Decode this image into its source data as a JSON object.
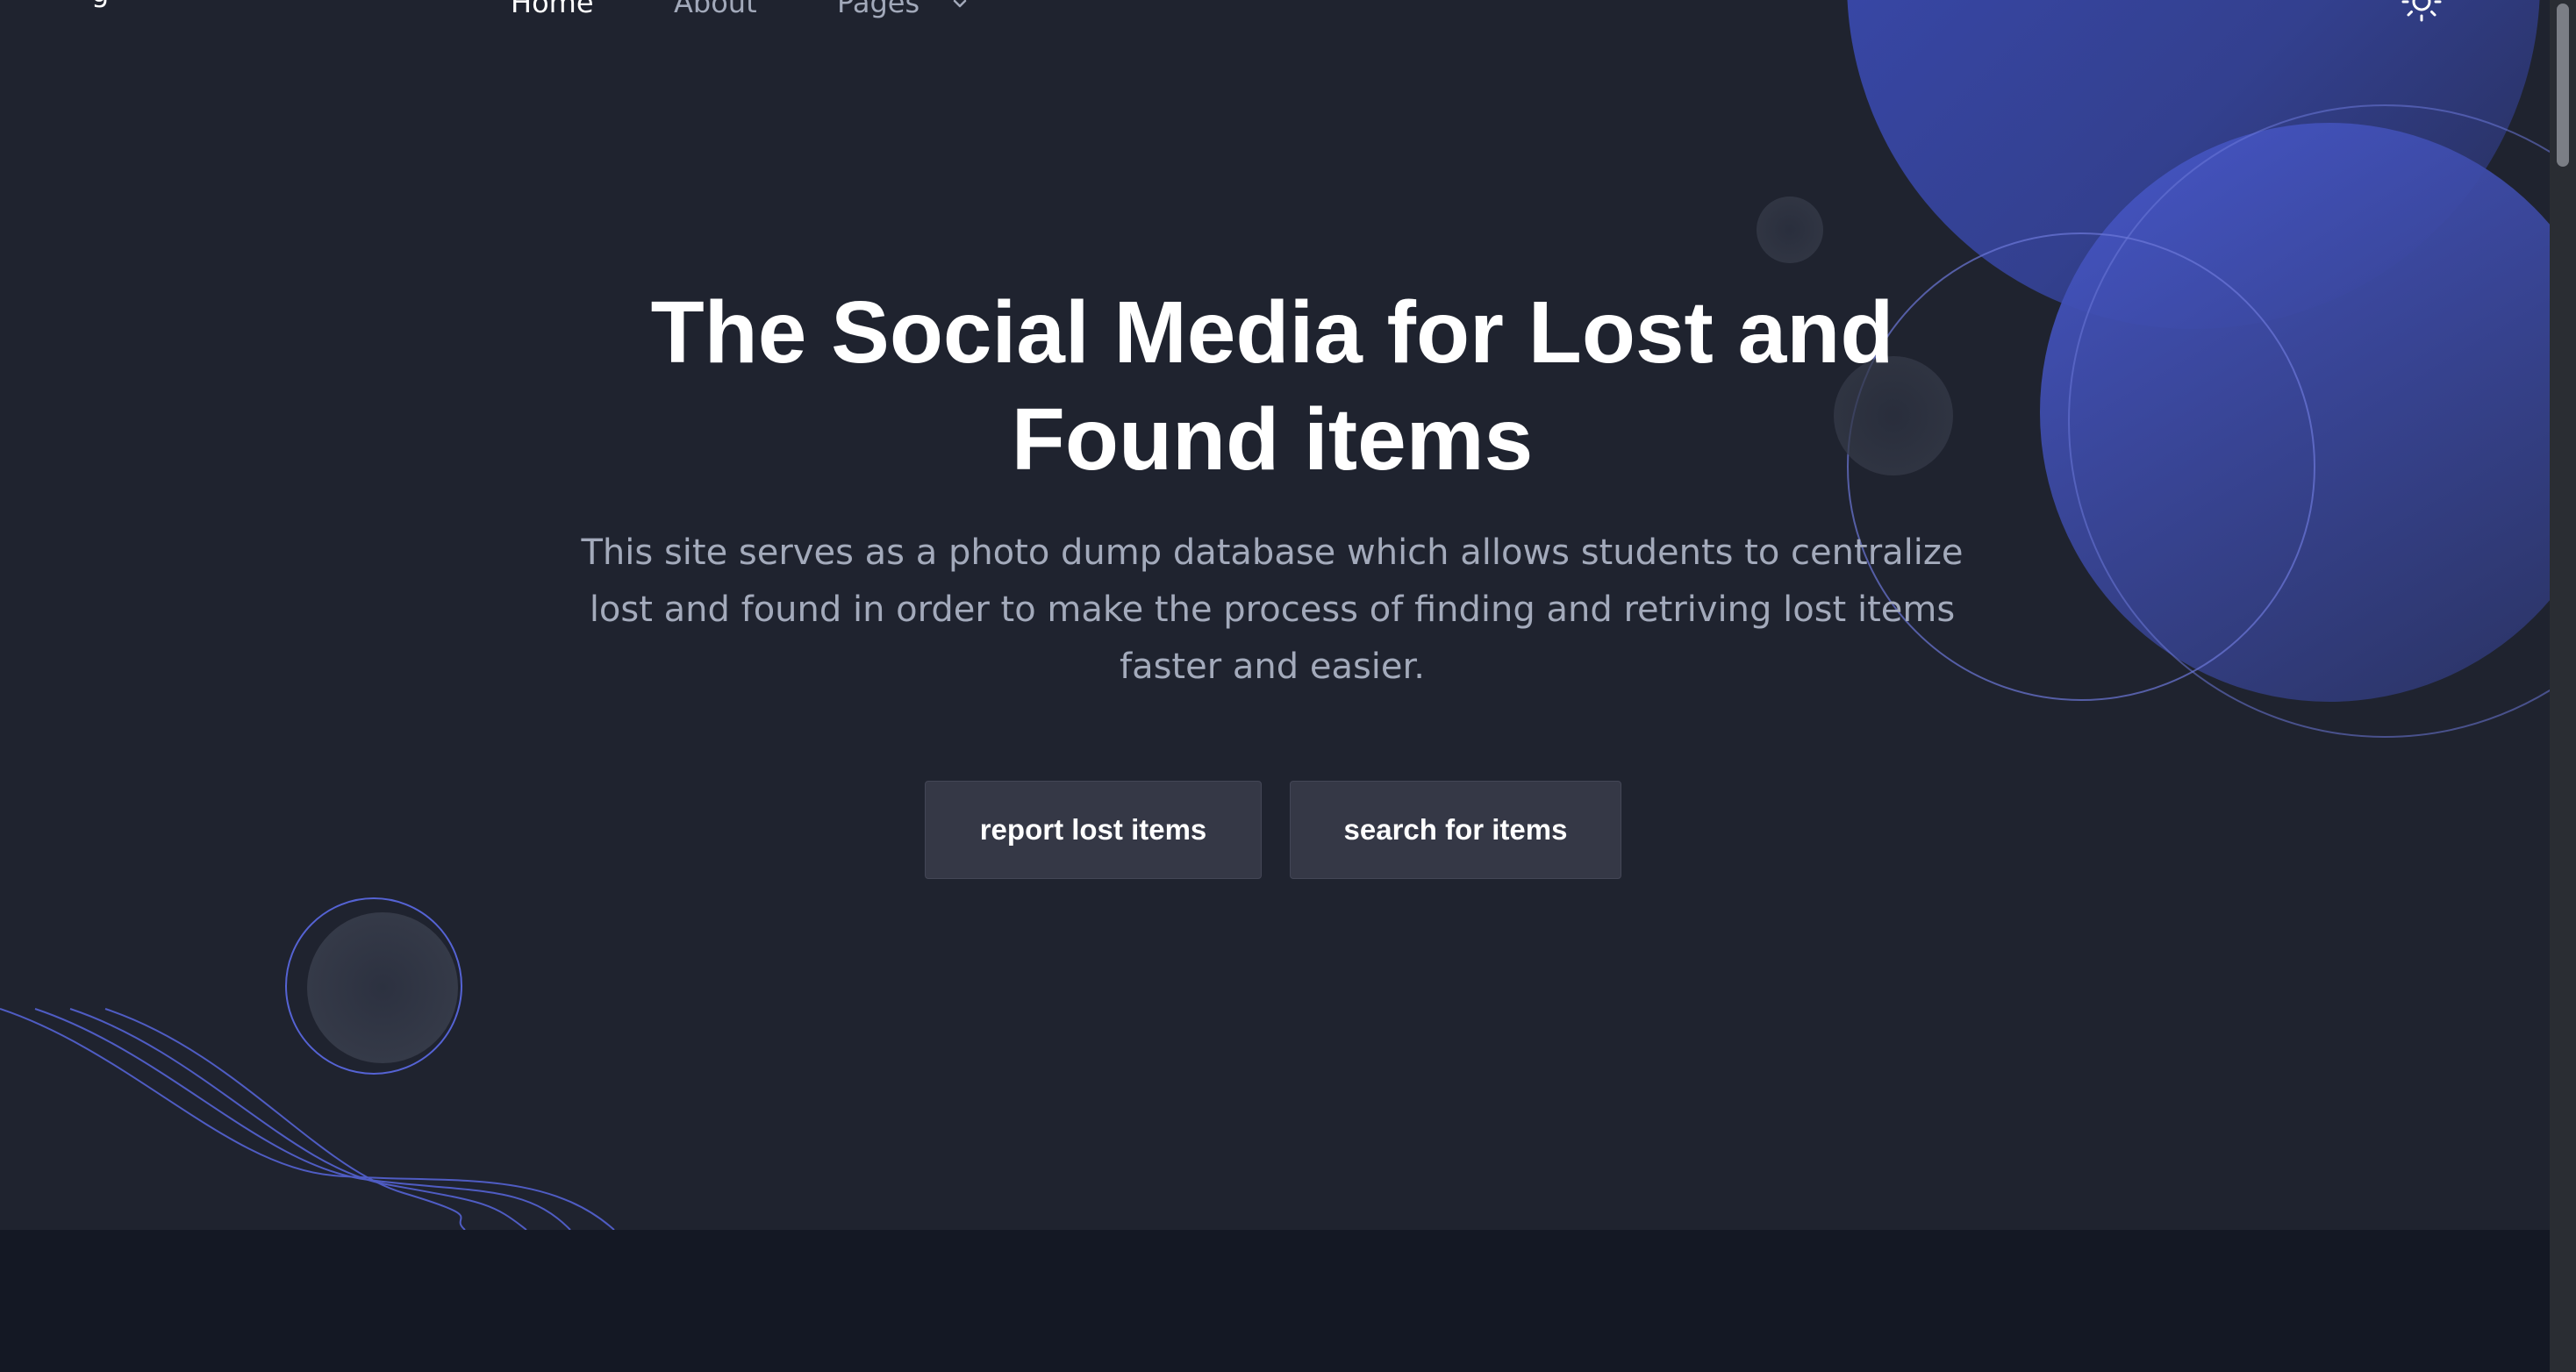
{
  "nav": {
    "brand_fragment": "g",
    "items": [
      {
        "label": "Home",
        "active": true
      },
      {
        "label": "About",
        "active": false
      },
      {
        "label": "Pages",
        "active": false
      }
    ],
    "pages_icon": "chevron-down-icon",
    "theme_toggle_icon": "sun-icon"
  },
  "hero": {
    "title": "The Social Media for Lost and Found items",
    "description": "This site serves as a photo dump database which allows students to centralize lost and found in order to make the process of finding and retriving lost items faster and easier.",
    "buttons": {
      "report_label": "report lost items",
      "search_label": "search for items"
    }
  },
  "colors": {
    "background": "#1f232f",
    "footer": "#141824",
    "accent": "#4b5bd6",
    "button_bg": "#353846",
    "text_primary": "#ffffff",
    "text_muted": "#a3aabb"
  }
}
